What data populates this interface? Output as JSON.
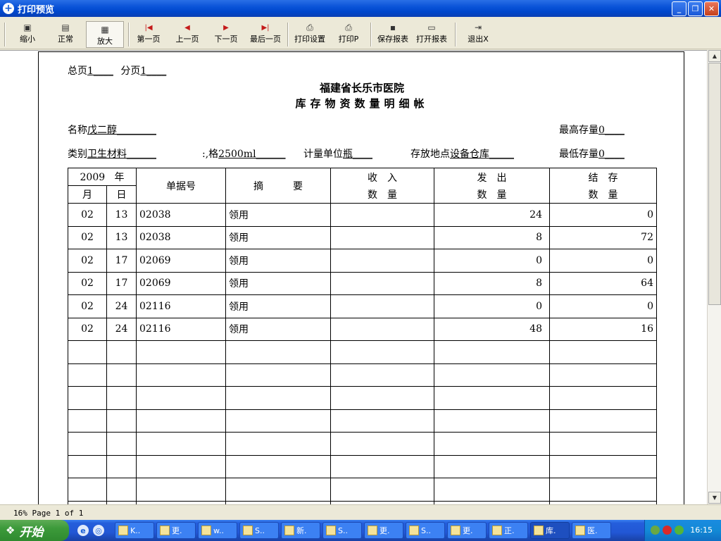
{
  "window": {
    "title": "打印预览",
    "title_icon": "+",
    "min": "_",
    "max": "❐",
    "close": "✕"
  },
  "toolbar": {
    "shrink": "缩小",
    "normal": "正常",
    "zoom": "放大",
    "first": "第一页",
    "prev": "上一页",
    "next": "下一页",
    "last": "最后一页",
    "print_setup": "打印设置",
    "print": "打印P",
    "save_report": "保存报表",
    "open_report": "打开报表",
    "exit": "退出X"
  },
  "report": {
    "total_pages_label": "总页",
    "total_pages": "1____",
    "sub_page_label": "分页",
    "sub_page": "1____",
    "title": "福建省长乐市医院",
    "subtitle": "库存物资数量明细帐",
    "name_label": "名称",
    "name": "戊二醇________",
    "max_stock_label": "最高存量",
    "max_stock": "0____",
    "category_label": "类别",
    "category": "卫生材料______",
    "spec_label": ":,格",
    "spec": "2500ml______",
    "unit_label": "计量单位",
    "unit": "瓶____",
    "location_label": "存放地点",
    "location": "设备仓库_____",
    "min_stock_label": "最低存量",
    "min_stock": "0____"
  },
  "table": {
    "year": "2009",
    "year_label": "年",
    "month_label": "月",
    "day_label": "日",
    "doc_no": "单据号",
    "summary": "摘　　　要",
    "income_top": "收　入",
    "income_bottom": "数　量",
    "issue_top": "发　出",
    "issue_bottom": "数　量",
    "balance_top": "结　存",
    "balance_bottom": "数　量",
    "rows": [
      {
        "month": "02",
        "day": "13",
        "doc": "02038",
        "summary": "领用",
        "in": "",
        "out": "24",
        "bal": "0"
      },
      {
        "month": "02",
        "day": "13",
        "doc": "02038",
        "summary": "领用",
        "in": "",
        "out": "8",
        "bal": "72"
      },
      {
        "month": "02",
        "day": "17",
        "doc": "02069",
        "summary": "领用",
        "in": "",
        "out": "0",
        "bal": "0"
      },
      {
        "month": "02",
        "day": "17",
        "doc": "02069",
        "summary": "领用",
        "in": "",
        "out": "8",
        "bal": "64"
      },
      {
        "month": "02",
        "day": "24",
        "doc": "02116",
        "summary": "领用",
        "in": "",
        "out": "0",
        "bal": "0"
      },
      {
        "month": "02",
        "day": "24",
        "doc": "02116",
        "summary": "领用",
        "in": "",
        "out": "48",
        "bal": "16"
      }
    ]
  },
  "status": {
    "text": "16% Page 1 of 1"
  },
  "taskbar": {
    "start": "开始",
    "tasks": [
      "K..",
      "更.",
      "w..",
      "S..",
      "新.",
      "S..",
      "更.",
      "S..",
      "更.",
      "正.",
      "库.",
      "医."
    ],
    "clock": "16:15"
  }
}
